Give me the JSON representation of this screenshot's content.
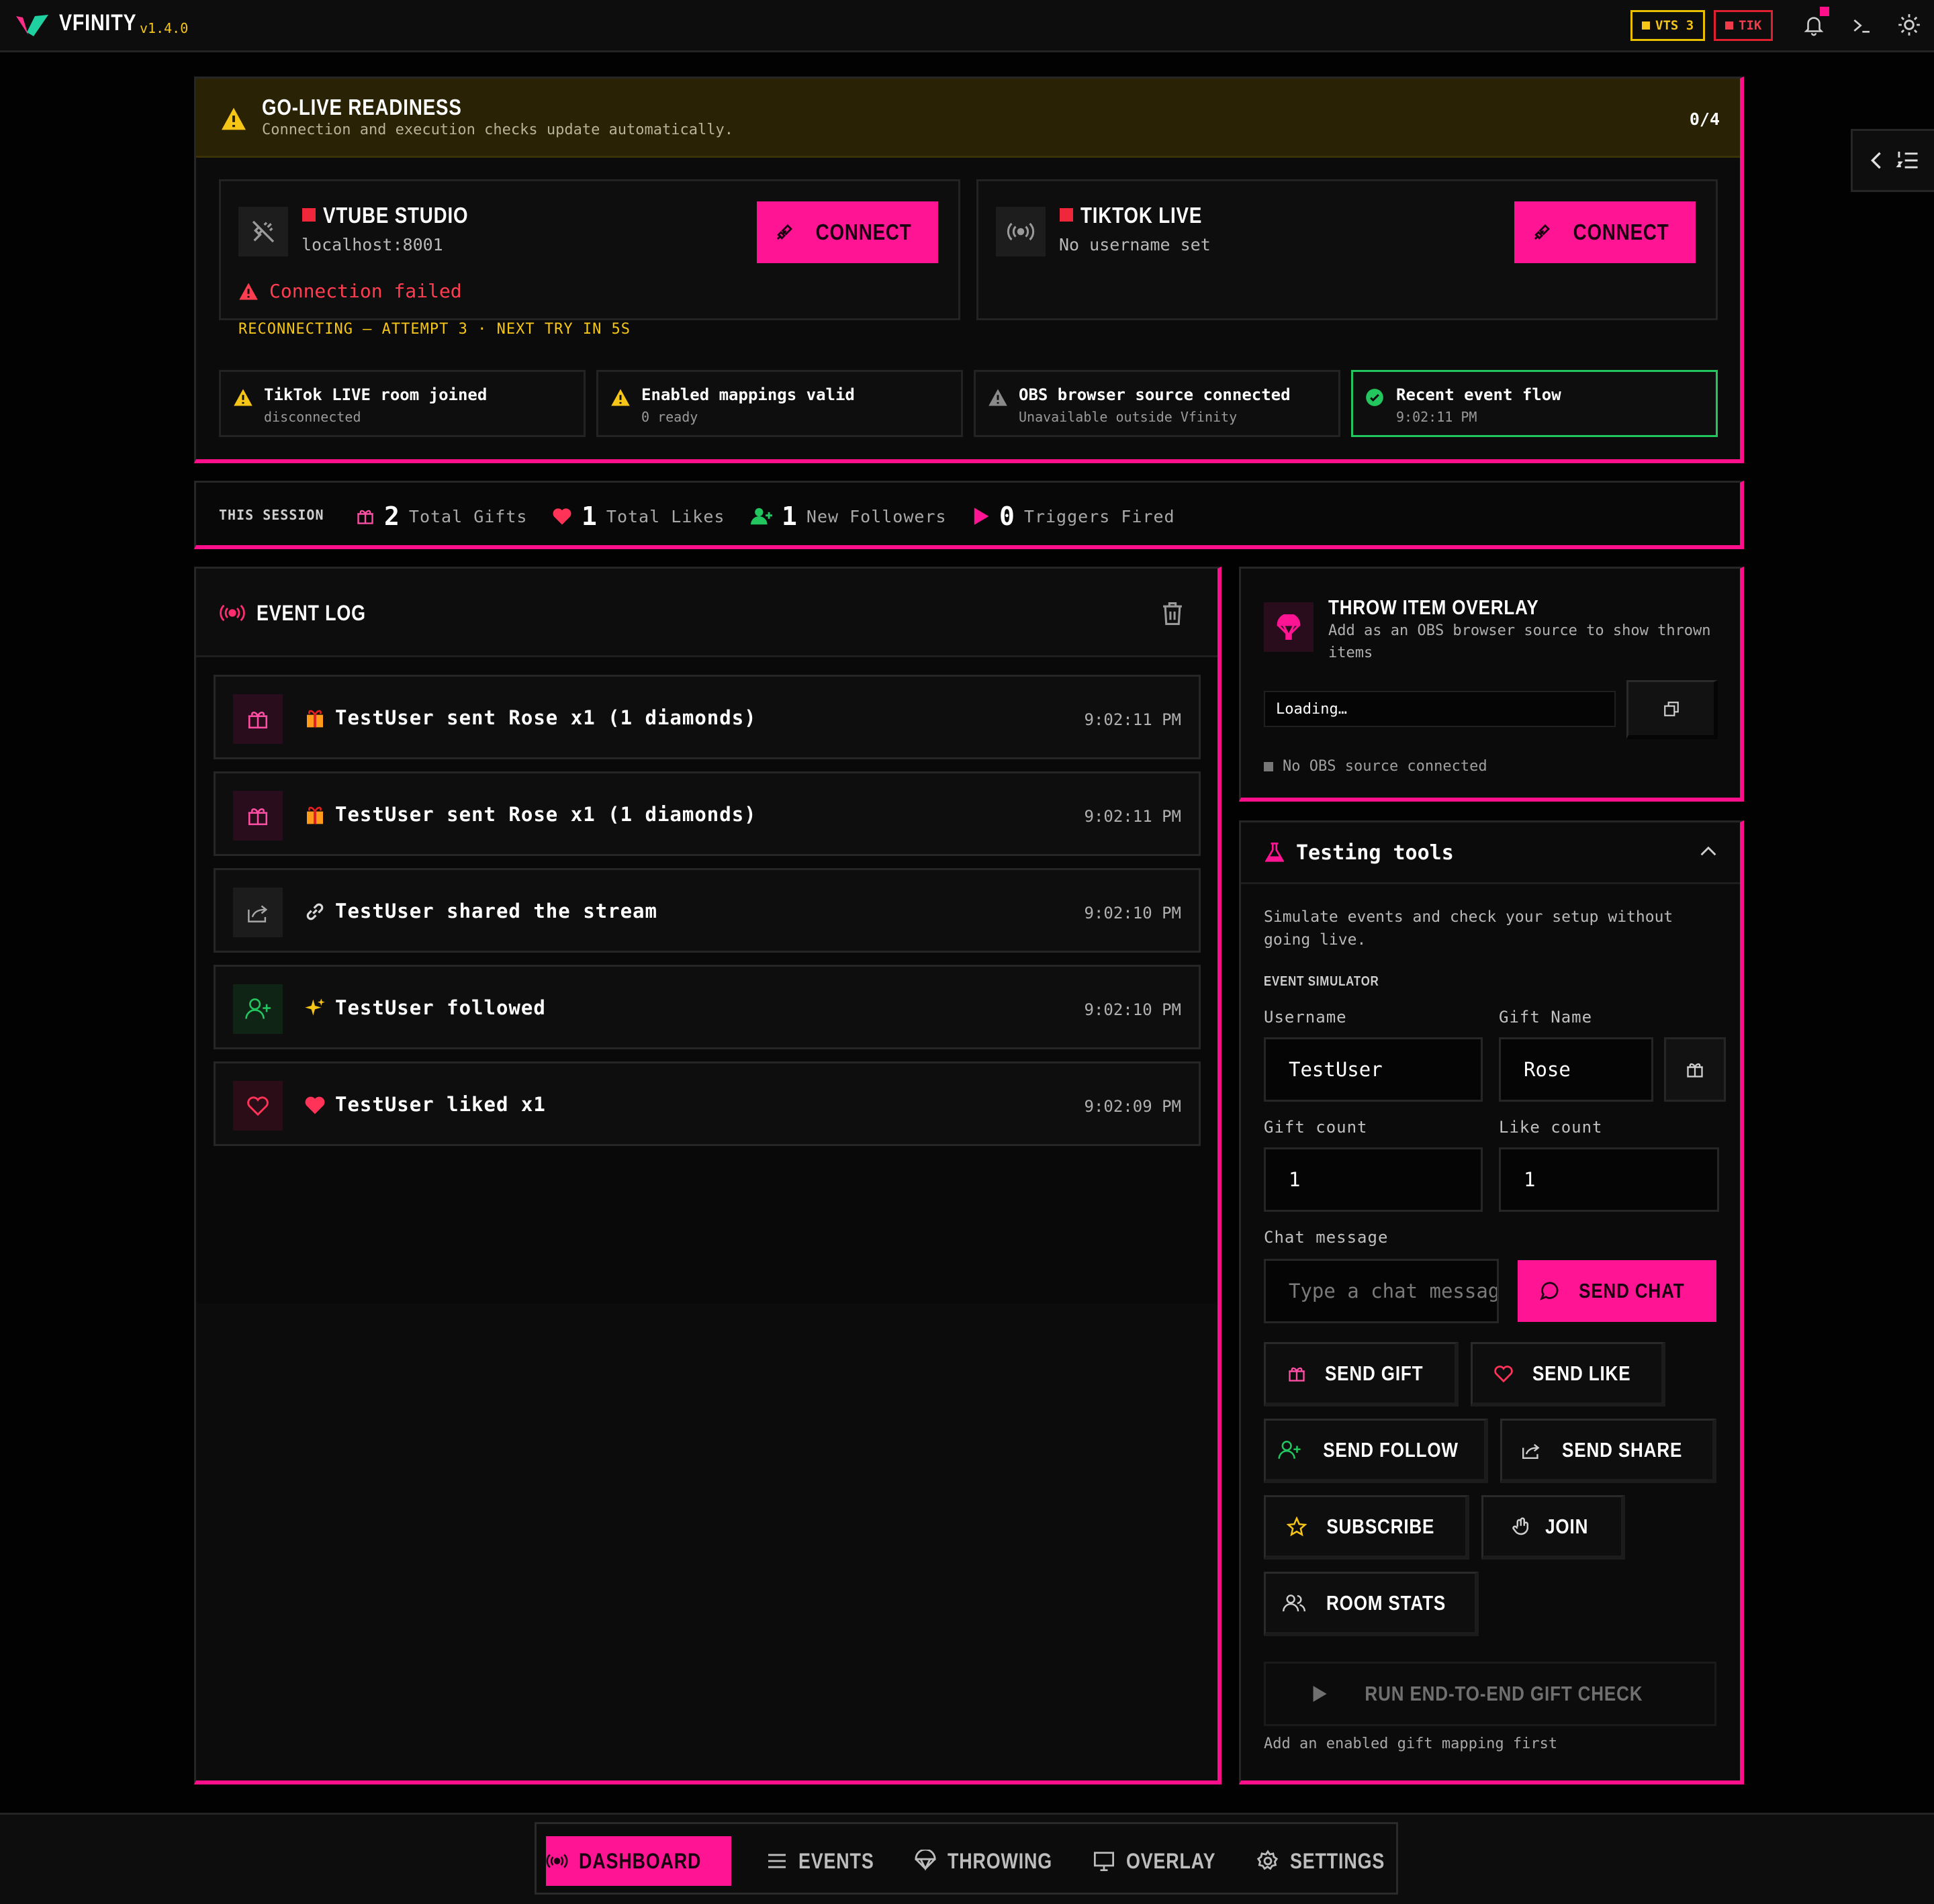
{
  "app": {
    "name": "VFINITY",
    "version": "v1.4.0"
  },
  "topbar": {
    "chips": [
      {
        "label": "VTS 3",
        "color": "#f5c518"
      },
      {
        "label": "TIK",
        "color": "#f23b4a"
      }
    ],
    "icons": [
      "bell-icon",
      "terminal-icon",
      "sun-icon"
    ]
  },
  "readiness": {
    "title": "GO-LIVE READINESS",
    "subtitle": "Connection and execution checks update automatically.",
    "count": "0/4",
    "connections": [
      {
        "name": "VTUBE STUDIO",
        "detail": "localhost:8001",
        "button": "CONNECT",
        "error": "Connection failed",
        "retry": "RECONNECTING — ATTEMPT 3 · NEXT TRY IN 5S"
      },
      {
        "name": "TIKTOK LIVE",
        "detail": "No username set",
        "button": "CONNECT"
      }
    ],
    "checks": [
      {
        "title": "TikTok LIVE room joined",
        "sub": "disconnected",
        "state": "warn"
      },
      {
        "title": "Enabled mappings valid",
        "sub": "0 ready",
        "state": "warn"
      },
      {
        "title": "OBS browser source connected",
        "sub": "Unavailable outside Vfinity",
        "state": "neutral"
      },
      {
        "title": "Recent event flow",
        "sub": "9:02:11 PM",
        "state": "ok"
      }
    ]
  },
  "session": {
    "label": "THIS SESSION",
    "stats": [
      {
        "value": "2",
        "label": "Total Gifts"
      },
      {
        "value": "1",
        "label": "Total Likes"
      },
      {
        "value": "1",
        "label": "New Followers"
      },
      {
        "value": "0",
        "label": "Triggers Fired"
      }
    ]
  },
  "event_log": {
    "title": "EVENT LOG",
    "events": [
      {
        "kind": "gift",
        "text": "TestUser sent Rose x1 (1 diamonds)",
        "time": "9:02:11 PM"
      },
      {
        "kind": "gift",
        "text": "TestUser sent Rose x1 (1 diamonds)",
        "time": "9:02:11 PM"
      },
      {
        "kind": "share",
        "text": "TestUser shared the stream",
        "time": "9:02:10 PM"
      },
      {
        "kind": "follow",
        "text": "TestUser followed",
        "time": "9:02:10 PM"
      },
      {
        "kind": "like",
        "text": "TestUser liked x1",
        "time": "9:02:09 PM"
      }
    ]
  },
  "throw_overlay": {
    "title": "THROW ITEM OVERLAY",
    "subtitle": "Add as an OBS browser source to show thrown items",
    "url_value": "Loading…",
    "status": "No OBS source connected"
  },
  "testing": {
    "title": "Testing tools",
    "description": "Simulate events and check your setup without going live.",
    "section": "EVENT SIMULATOR",
    "labels": {
      "username": "Username",
      "gift_name": "Gift Name",
      "gift_count": "Gift count",
      "like_count": "Like count",
      "chat": "Chat message"
    },
    "values": {
      "username": "TestUser",
      "gift_name": "Rose",
      "gift_count": "1",
      "like_count": "1"
    },
    "chat_placeholder": "Type a chat message",
    "send_chat": "SEND CHAT",
    "buttons": {
      "gift": "SEND GIFT",
      "like": "SEND LIKE",
      "follow": "SEND FOLLOW",
      "share": "SEND SHARE",
      "subscribe": "SUBSCRIBE",
      "join": "JOIN",
      "room_stats": "ROOM STATS"
    },
    "run_check": "RUN END-TO-END GIFT CHECK",
    "run_note": "Add an enabled gift mapping first"
  },
  "nav": {
    "items": [
      {
        "label": "DASHBOARD",
        "active": true
      },
      {
        "label": "EVENTS"
      },
      {
        "label": "THROWING"
      },
      {
        "label": "OVERLAY"
      },
      {
        "label": "SETTINGS"
      }
    ]
  },
  "colors": {
    "accent": "#ff1493",
    "warning": "#f5c518",
    "error": "#f23b4a",
    "success": "#22c55e"
  }
}
